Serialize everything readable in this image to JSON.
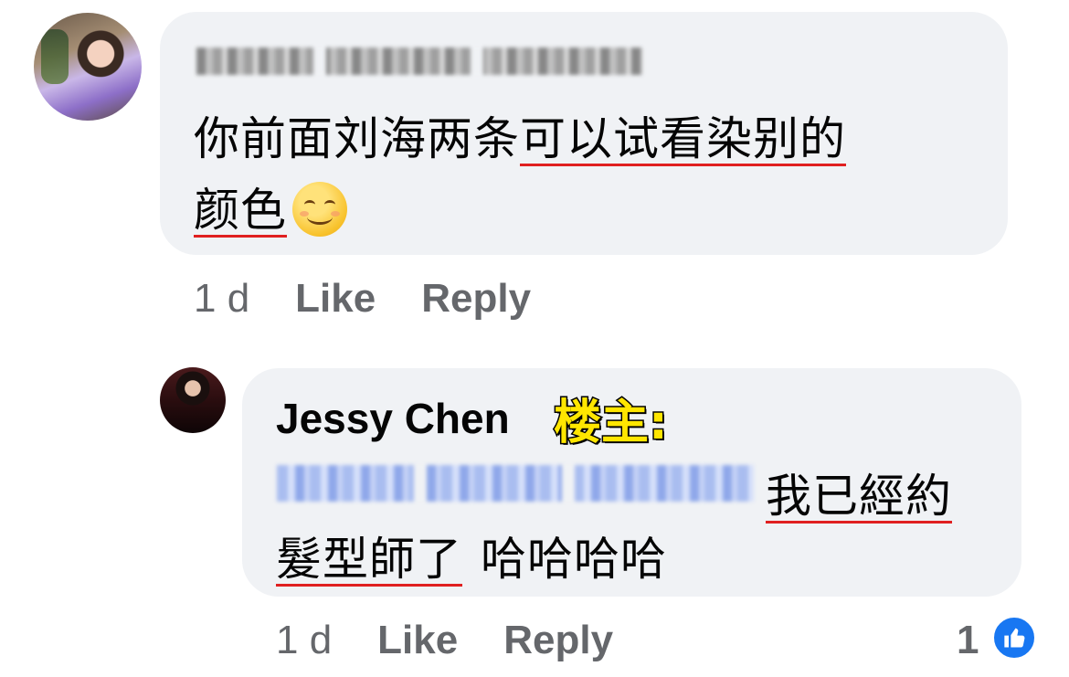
{
  "comment": {
    "text_line1_plain": "你前面刘海两条",
    "text_line1_underlined": "可以试看染别的",
    "text_line2_underlined": "颜色",
    "emoji": "smiling-face-icon",
    "meta": {
      "time": "1 d",
      "like": "Like",
      "reply": "Reply"
    }
  },
  "reply": {
    "author": "Jessy Chen",
    "op_tag": "楼主:",
    "text_line1_underlined": "我已經約",
    "text_line2_underlined": "髮型師了",
    "text_line2_plain": "哈哈哈哈",
    "meta": {
      "time": "1 d",
      "like": "Like",
      "reply": "Reply"
    },
    "reaction_count": "1",
    "reaction_icon": "thumbs-up-icon"
  },
  "colors": {
    "bubble": "#f0f2f5",
    "meta": "#65676b",
    "underline": "#e02020",
    "like_blue": "#1877f2",
    "op_tag": "#ffe600"
  }
}
